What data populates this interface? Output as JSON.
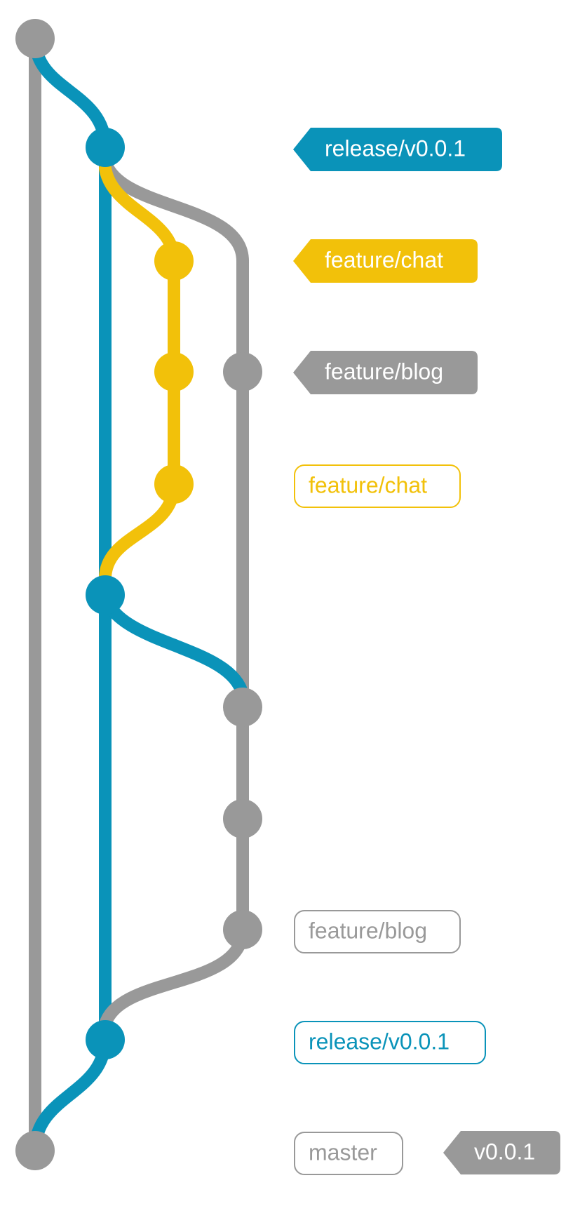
{
  "colors": {
    "master": "#999999",
    "release": "#0a93b9",
    "feature_chat": "#f2c10a",
    "feature_blog": "#999999",
    "label_text_filled": "#ffffff",
    "background": "#ffffff"
  },
  "tags": {
    "release_head": "release/v0.0.1",
    "chat_head": "feature/chat",
    "blog_head": "feature/blog",
    "version_tag": "v0.0.1"
  },
  "branch_origins": {
    "chat": "feature/chat",
    "blog": "feature/blog",
    "release": "release/v0.0.1",
    "master": "master"
  }
}
